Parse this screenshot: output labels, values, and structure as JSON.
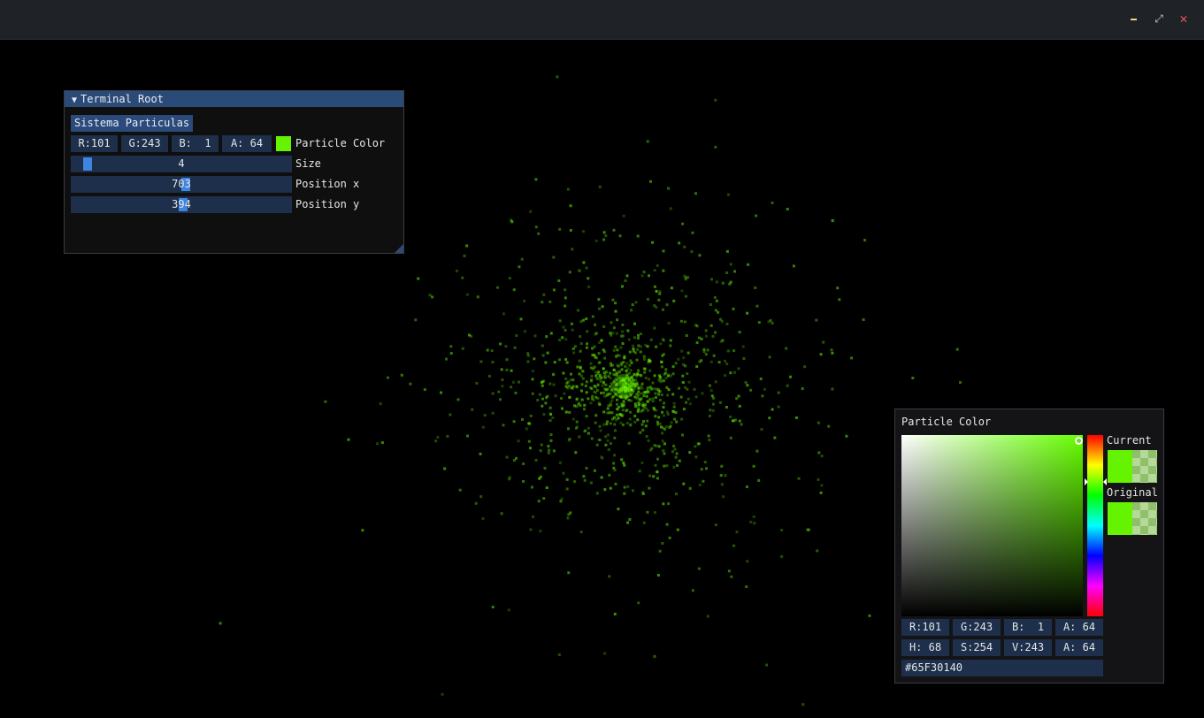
{
  "window": {
    "controls": {
      "minimize": "minimize-icon",
      "maximize": "restore-icon",
      "close": "close-icon"
    },
    "colors": {
      "titlebar": "#1f2227",
      "close": "#e25563",
      "minimize": "#f2d97a"
    }
  },
  "root_panel": {
    "title": "Terminal Root",
    "collapse_icon": "▼",
    "button_label": "Sistema Particulas",
    "color_fields": {
      "r": "R:101",
      "g": "G:243",
      "b": "B:  1",
      "a": "A: 64"
    },
    "color_label": "Particle Color",
    "swatch_color": "#65f301",
    "size": {
      "value": "4",
      "label": "Size",
      "fraction": 0.05
    },
    "position_x": {
      "value": "703",
      "label": "Position x",
      "fraction": 0.52
    },
    "position_y": {
      "value": "394",
      "label": "Position y",
      "fraction": 0.51
    }
  },
  "color_picker": {
    "title": "Particle Color",
    "current_label": "Current",
    "original_label": "Original",
    "rgba": {
      "r": "R:101",
      "g": "G:243",
      "b": "B:  1",
      "a": "A: 64"
    },
    "hsva": {
      "h": "H: 68",
      "s": "S:254",
      "v": "V:243",
      "a": "A: 64"
    },
    "hex": "#65F30140",
    "current_color": "#65f301",
    "hue_color": "#66ff00"
  },
  "scene": {
    "particle_color": "#65f301"
  }
}
